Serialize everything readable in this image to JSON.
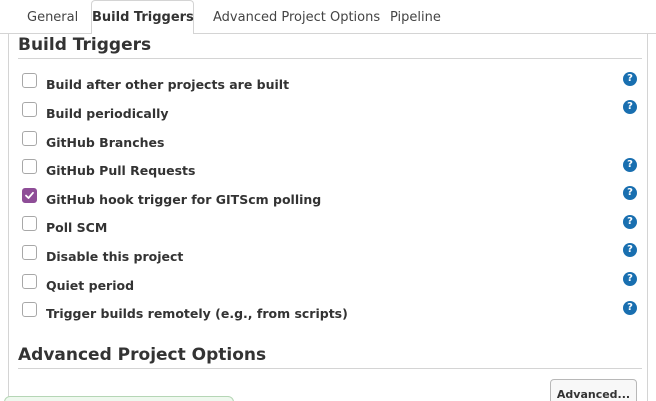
{
  "tabs": [
    {
      "label": "General",
      "active": false
    },
    {
      "label": "Build Triggers",
      "active": true
    },
    {
      "label": "Advanced Project Options",
      "active": false
    },
    {
      "label": "Pipeline",
      "active": false
    }
  ],
  "build_triggers": {
    "title": "Build Triggers",
    "items": [
      {
        "label": "Build after other projects are built",
        "checked": false,
        "help": true
      },
      {
        "label": "Build periodically",
        "checked": false,
        "help": true
      },
      {
        "label": "GitHub Branches",
        "checked": false,
        "help": false
      },
      {
        "label": "GitHub Pull Requests",
        "checked": false,
        "help": true
      },
      {
        "label": "GitHub hook trigger for GITScm polling",
        "checked": true,
        "help": true
      },
      {
        "label": "Poll SCM",
        "checked": false,
        "help": true
      },
      {
        "label": "Disable this project",
        "checked": false,
        "help": true
      },
      {
        "label": "Quiet period",
        "checked": false,
        "help": true
      },
      {
        "label": "Trigger builds remotely (e.g., from scripts)",
        "checked": false,
        "help": true
      }
    ]
  },
  "advanced_options": {
    "title": "Advanced Project Options",
    "button_label": "Advanced..."
  },
  "help_glyph": "?",
  "colors": {
    "accent_checkbox": "#8e4d97",
    "help_icon": "#196fb0"
  }
}
